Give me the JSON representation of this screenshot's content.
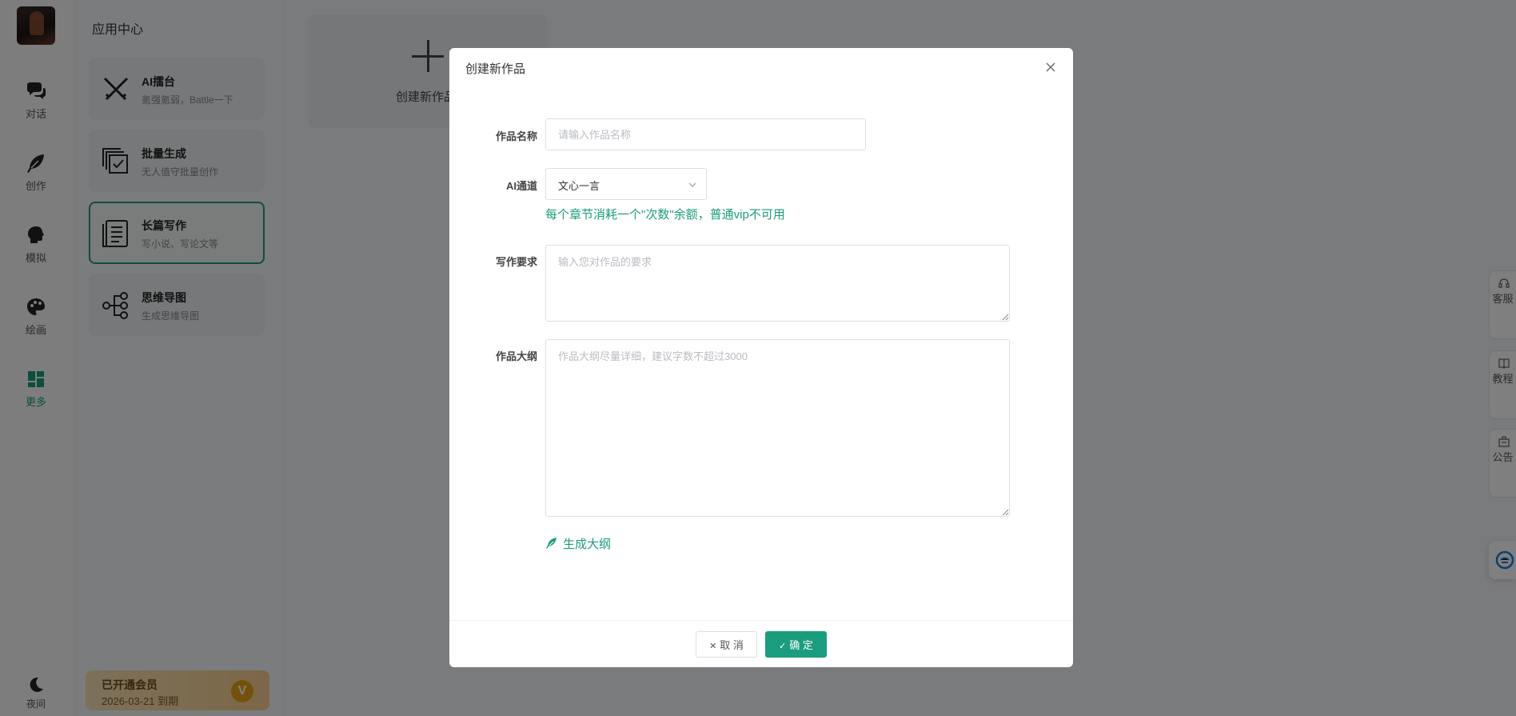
{
  "nav": {
    "items": [
      {
        "label": "对话",
        "icon": "chat-icon"
      },
      {
        "label": "创作",
        "icon": "feather-icon"
      },
      {
        "label": "模拟",
        "icon": "head-icon"
      },
      {
        "label": "绘画",
        "icon": "palette-icon"
      },
      {
        "label": "更多",
        "icon": "grid-icon"
      }
    ],
    "night_label": "夜间",
    "accent_color": "#1a9d7e"
  },
  "panel": {
    "title": "应用中心",
    "apps": [
      {
        "title": "AI擂台",
        "subtitle": "氪强氪弱，Battle一下"
      },
      {
        "title": "批量生成",
        "subtitle": "无人值守批量创作"
      },
      {
        "title": "长篇写作",
        "subtitle": "写小说、写论文等"
      },
      {
        "title": "思维导图",
        "subtitle": "生成思维导图"
      }
    ],
    "vip": {
      "title": "已开通会员",
      "expire": "2026-03-21 到期",
      "badge": "V"
    }
  },
  "main": {
    "new_work_label": "创建新作品"
  },
  "side_tabs": [
    {
      "label": "客服",
      "icon": "headset-icon"
    },
    {
      "label": "教程",
      "icon": "book-icon"
    },
    {
      "label": "公告",
      "icon": "notice-icon"
    }
  ],
  "dialog": {
    "title": "创建新作品",
    "name_label": "作品名称",
    "name_placeholder": "请输入作品名称",
    "channel_label": "AI通道",
    "channel_value": "文心一言",
    "channel_hint": "每个章节消耗一个\"次数\"余额，普通vip不可用",
    "requirement_label": "写作要求",
    "requirement_placeholder": "输入您对作品的要求",
    "outline_label": "作品大纲",
    "outline_placeholder": "作品大纲尽量详细，建议字数不超过3000",
    "generate_outline": "生成大纲",
    "cancel": "取 消",
    "confirm": "确 定"
  }
}
